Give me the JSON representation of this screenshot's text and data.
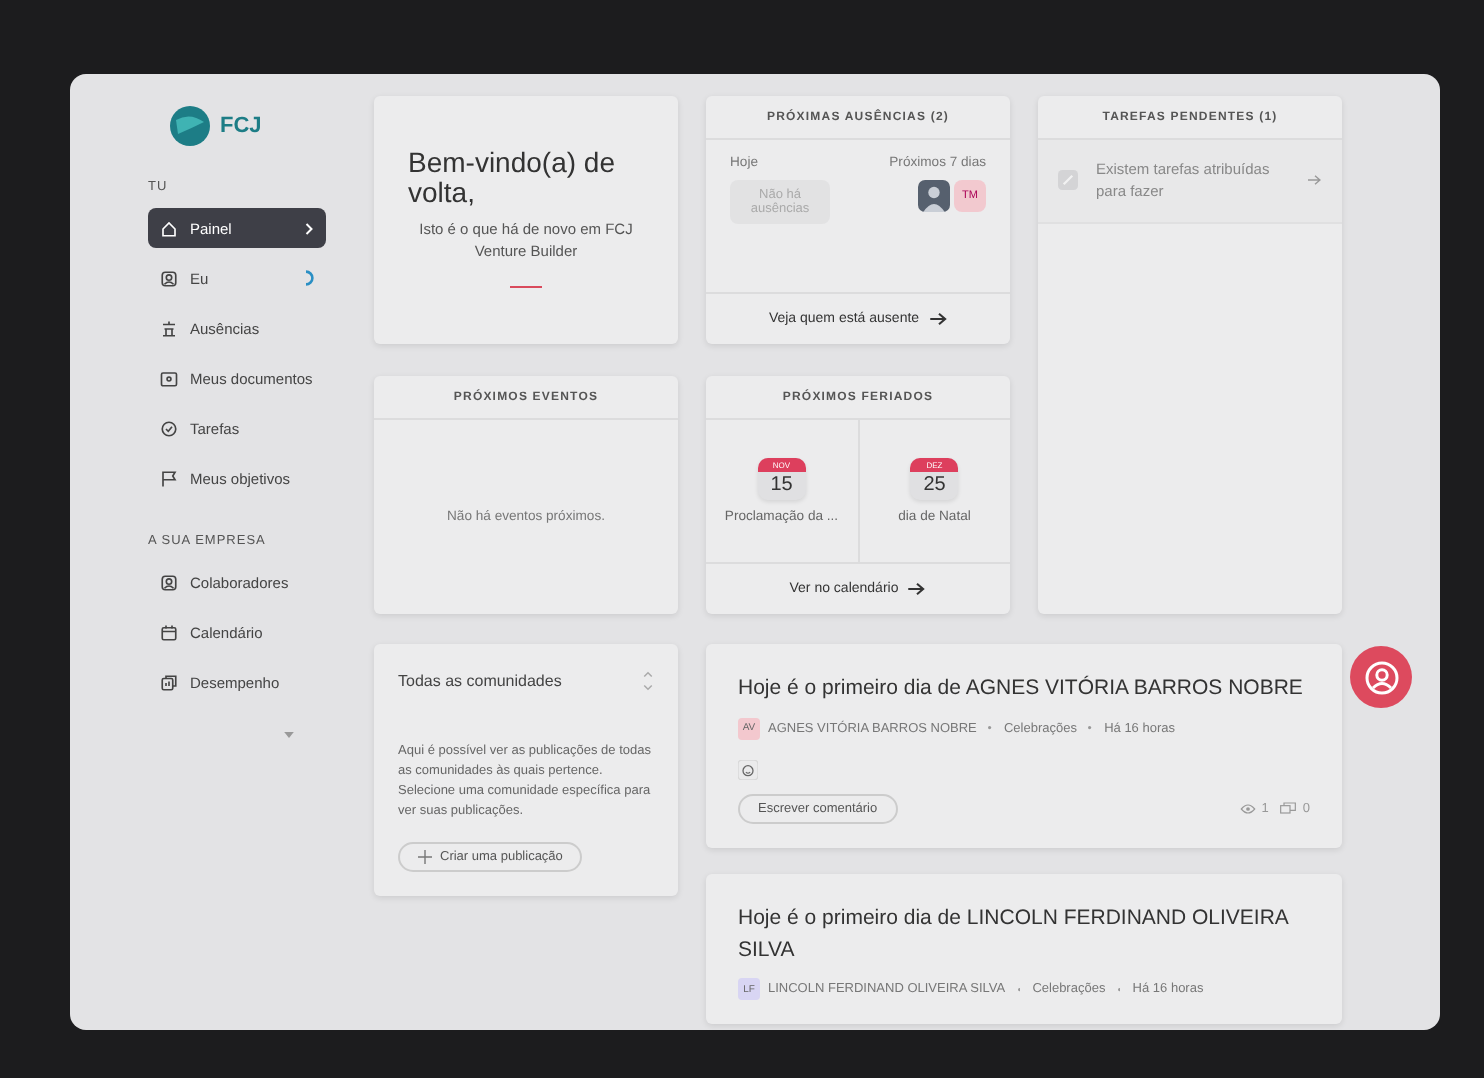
{
  "sidebar": {
    "logo": "FCJ",
    "sections": [
      {
        "title": "TU",
        "items": [
          {
            "label": "Painel",
            "selected": true
          },
          {
            "label": "Eu",
            "selected": false,
            "busy": true
          },
          {
            "label": "Ausências",
            "selected": false
          },
          {
            "label": "Meus documentos",
            "selected": false
          },
          {
            "label": "Tarefas",
            "selected": false
          },
          {
            "label": "Meus objetivos",
            "selected": false
          }
        ]
      },
      {
        "title": "A SUA EMPRESA",
        "items": [
          {
            "label": "Colaboradores",
            "selected": false
          },
          {
            "label": "Calendário",
            "selected": false
          },
          {
            "label": "Desempenho",
            "selected": false
          }
        ]
      }
    ]
  },
  "welcome": {
    "title": "Bem-vindo(a) de volta,",
    "subtitle": "Isto é o que há de novo em FCJ Venture Builder"
  },
  "absences": {
    "title": "PRÓXIMAS AUSÊNCIAS (2)",
    "today_label": "Hoje",
    "today_empty": "Não há ausências",
    "next_label": "Próximos 7 dias",
    "people": [
      {
        "kind": "photo"
      },
      {
        "kind": "initials",
        "initials": "TM",
        "color": "#f2c9cf"
      }
    ],
    "link": "Veja quem está ausente"
  },
  "tasks": {
    "title": "TAREFAS PENDENTES (1)",
    "item": "Existem tarefas atribuídas para fazer"
  },
  "events": {
    "title": "PRÓXIMOS EVENTOS",
    "empty": "Não há eventos próximos."
  },
  "holidays": {
    "title": "PRÓXIMOS FERIADOS",
    "items": [
      {
        "month": "NOV",
        "day": "15",
        "name": "Proclamação da ..."
      },
      {
        "month": "DEZ",
        "day": "25",
        "name": "dia de Natal"
      }
    ],
    "link": "Ver no calendário"
  },
  "communities": {
    "title": "Todas as comunidades",
    "text": "Aqui é possível ver as publicações de todas as comunidades às quais pertence. Selecione uma comunidade específica para ver suas publicações.",
    "button": "Criar uma publicação"
  },
  "posts": [
    {
      "title": "Hoje é o primeiro dia de AGNES VITÓRIA BARROS NOBRE",
      "initials": "AV",
      "color": "#f3c8ce",
      "author": "AGNES VITÓRIA BARROS NOBRE",
      "category": "Celebrações",
      "time": "Há 16 horas",
      "comment_button": "Escrever comentário",
      "views": "1",
      "comments": "0"
    },
    {
      "title": "Hoje é o primeiro dia de LINCOLN FERDINAND OLIVEIRA SILVA",
      "initials": "LF",
      "color": "#d8d5f3",
      "author": "LINCOLN FERDINAND OLIVEIRA SILVA",
      "category": "Celebrações",
      "time": "Há 16 horas"
    }
  ]
}
